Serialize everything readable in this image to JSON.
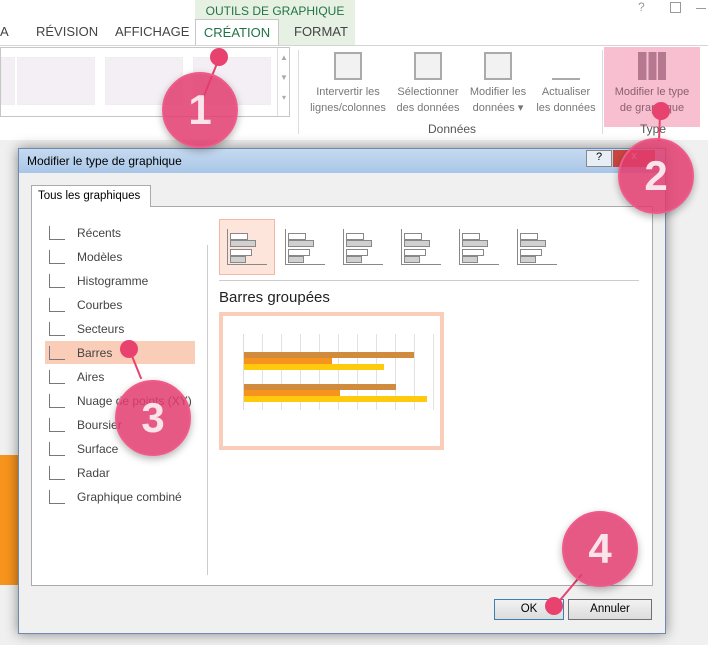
{
  "ribbon": {
    "context_title": "OUTILS DE GRAPHIQUE",
    "tabs": [
      {
        "label": "A"
      },
      {
        "label": "RÉVISION"
      },
      {
        "label": "AFFICHAGE"
      },
      {
        "label": "CRÉATION",
        "active": true
      },
      {
        "label": "FORMAT"
      }
    ],
    "buttons": [
      {
        "label1": "Intervertir les",
        "label2": "lignes/colonnes",
        "icon": "switch-row-column-icon"
      },
      {
        "label1": "Sélectionner",
        "label2": "des données",
        "icon": "select-data-icon"
      },
      {
        "label1": "Modifier les",
        "label2": "données ▾",
        "icon": "edit-data-icon"
      },
      {
        "label1": "Actualiser",
        "label2": "les données",
        "icon": "refresh-data-icon"
      },
      {
        "label1": "Modifier le type",
        "label2": "de graphique",
        "icon": "change-chart-type-icon"
      }
    ],
    "groups": {
      "data": "Données",
      "type": "Type"
    },
    "window": {
      "help": "?"
    }
  },
  "dialog": {
    "title": "Modifier le type de graphique",
    "help": "?",
    "close": "x",
    "tab": "Tous les graphiques",
    "categories": [
      {
        "label": "Récents",
        "icon": "recent-icon"
      },
      {
        "label": "Modèles",
        "icon": "folder-icon"
      },
      {
        "label": "Histogramme",
        "icon": "column-chart-icon"
      },
      {
        "label": "Courbes",
        "icon": "line-chart-icon"
      },
      {
        "label": "Secteurs",
        "icon": "pie-chart-icon"
      },
      {
        "label": "Barres",
        "icon": "bar-chart-icon",
        "selected": true
      },
      {
        "label": "Aires",
        "icon": "area-chart-icon"
      },
      {
        "label": "Nuage de points (XY)",
        "icon": "scatter-chart-icon"
      },
      {
        "label": "Boursier",
        "icon": "stock-chart-icon"
      },
      {
        "label": "Surface",
        "icon": "surface-chart-icon"
      },
      {
        "label": "Radar",
        "icon": "radar-chart-icon"
      },
      {
        "label": "Graphique combiné",
        "icon": "combo-chart-icon"
      }
    ],
    "subtype_selected": "Barres groupées",
    "ok": "OK",
    "cancel": "Annuler"
  },
  "colors": {
    "accent": "#217346",
    "selection": "#f9cdb7",
    "badge": "#e23c6e",
    "series": [
      "#d18b3d",
      "#f7941d",
      "#ffc90e"
    ]
  },
  "badges": [
    "1",
    "2",
    "3",
    "4"
  ]
}
